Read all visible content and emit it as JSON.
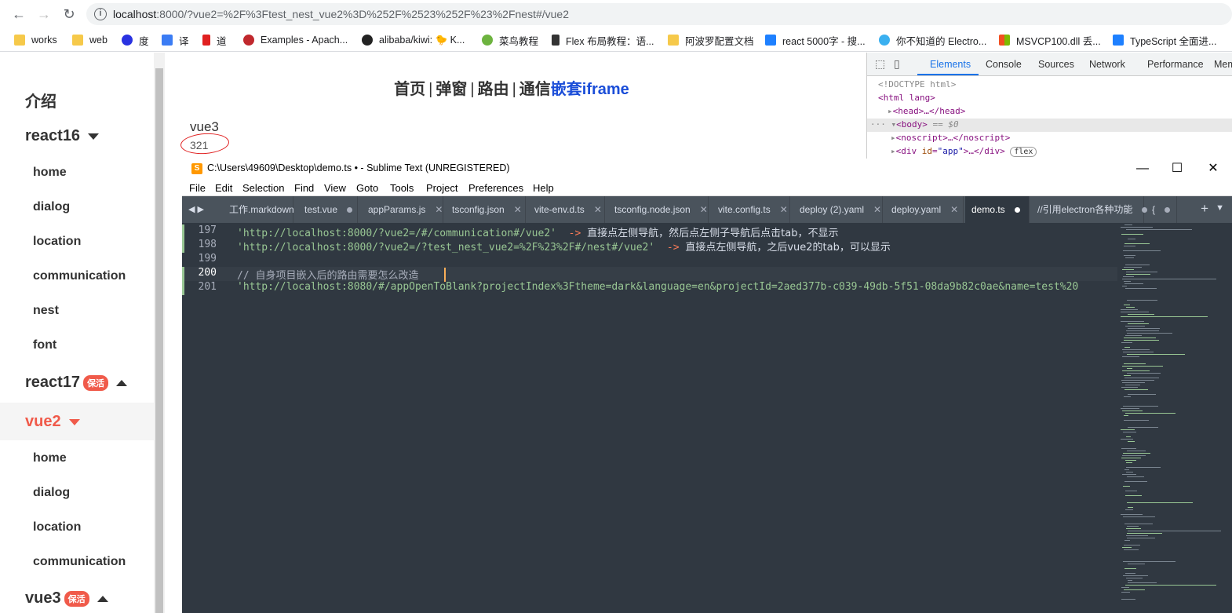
{
  "browser": {
    "url_host": "localhost",
    "url_rest": ":8000/?vue2=%2F%3Ftest_nest_vue2%3D%252F%2523%252F%23%2Fnest#/vue2",
    "bookmarks": [
      {
        "label": "works"
      },
      {
        "label": "web"
      },
      {
        "label": "度"
      },
      {
        "label": "译"
      },
      {
        "label": "道"
      },
      {
        "label": "Examples - Apach..."
      },
      {
        "label": "alibaba/kiwi: 🐤 K..."
      },
      {
        "label": "菜鸟教程"
      },
      {
        "label": "Flex 布局教程：语..."
      },
      {
        "label": "阿波罗配置文档"
      },
      {
        "label": "react 5000字 - 搜..."
      },
      {
        "label": "你不知道的 Electro..."
      },
      {
        "label": "MSVCP100.dll 丢..."
      },
      {
        "label": "TypeScript 全面进..."
      }
    ]
  },
  "sidebar": {
    "intro": "介绍",
    "react16": "react16",
    "react16_items": [
      "home",
      "dialog",
      "location",
      "communication",
      "nest",
      "font"
    ],
    "react17": "react17",
    "keepalive_badge": "保活",
    "vue2": "vue2",
    "vue2_items": [
      "home",
      "dialog",
      "location",
      "communication"
    ],
    "vue3": "vue3"
  },
  "main": {
    "nav": [
      "首页",
      "弹窗",
      "路由",
      "通信",
      "嵌套iframe"
    ],
    "sep": "|",
    "heading": "vue3",
    "number": "321"
  },
  "devtools": {
    "tabs": [
      "Elements",
      "Console",
      "Sources",
      "Network",
      "Performance",
      "Mem"
    ],
    "doctype": "<!DOCTYPE html>",
    "html_tag": "<html lang>",
    "head": "<head>…</head>",
    "body": "<body>",
    "body_suffix": "== $0",
    "noscript": "<noscript>…</noscript>",
    "div_app_open": "<div ",
    "div_app_attr": "id",
    "div_app_val": "\"app\"",
    "div_app_close": ">…</div>",
    "flex_badge": "flex",
    "dots": "···"
  },
  "sublime": {
    "title": "C:\\Users\\49609\\Desktop\\demo.ts • - Sublime Text (UNREGISTERED)",
    "menu": [
      "File",
      "Edit",
      "Selection",
      "Find",
      "View",
      "Goto",
      "Tools",
      "Project",
      "Preferences",
      "Help"
    ],
    "tabs": [
      {
        "label": "工作.markdown",
        "mark": ""
      },
      {
        "label": "test.vue",
        "mark": "dot"
      },
      {
        "label": "appParams.js",
        "mark": "x"
      },
      {
        "label": "tsconfig.json",
        "mark": "x"
      },
      {
        "label": "vite-env.d.ts",
        "mark": "x"
      },
      {
        "label": "tsconfig.node.json",
        "mark": "x"
      },
      {
        "label": "vite.config.ts",
        "mark": "x"
      },
      {
        "label": "deploy (2).yaml",
        "mark": "x"
      },
      {
        "label": "deploy.yaml",
        "mark": "x"
      },
      {
        "label": "demo.ts",
        "mark": "dot"
      },
      {
        "label": "//引用electron各种功能",
        "mark": "dot"
      },
      {
        "label": "{",
        "mark": "dot"
      }
    ],
    "lines": [
      {
        "num": "197",
        "str": "'http://localhost:8000/?vue2=/#/communication#/vue2'",
        "arrow": "->",
        "note": "直接点左侧导航，然后点左侧子导航后点击tab，不显示"
      },
      {
        "num": "198",
        "str": "'http://localhost:8000/?vue2=/?test_nest_vue2=%2F%23%2F#/nest#/vue2'",
        "arrow": "->",
        "note": "直接点左侧导航，之后vue2的tab，可以显示"
      },
      {
        "num": "199",
        "str": "",
        "arrow": "",
        "note": ""
      },
      {
        "num": "200",
        "comment": "// 自身项目嵌入后的路由需要怎么改造"
      },
      {
        "num": "201",
        "str": "'http://localhost:8080/#/appOpenToBlank?projectIndex%3Ftheme=dark&language=en&projectId=2aed377b-c039-49db-5f51-08da9b82c0ae&name=test%20"
      }
    ]
  },
  "colors": {
    "accent_red": "#f05a4a",
    "link_blue": "#1a4dd8",
    "editor_bg": "#303841",
    "string_green": "#99c794"
  }
}
